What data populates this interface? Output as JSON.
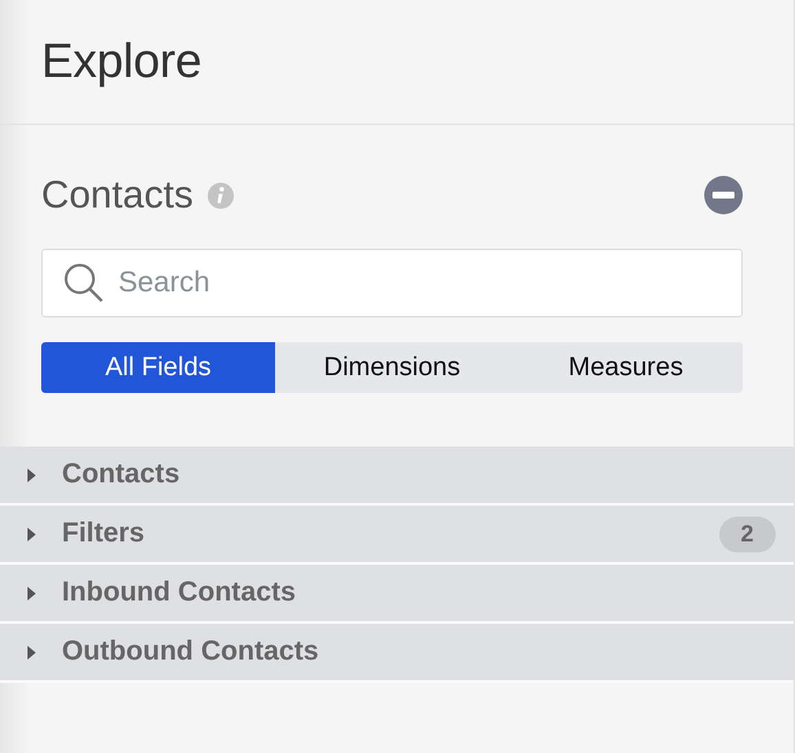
{
  "header": {
    "title": "Explore"
  },
  "explore": {
    "title": "Contacts",
    "search": {
      "placeholder": "Search"
    },
    "tabs": [
      {
        "label": "All Fields",
        "selected": true
      },
      {
        "label": "Dimensions",
        "selected": false
      },
      {
        "label": "Measures",
        "selected": false
      }
    ]
  },
  "groups": [
    {
      "label": "Contacts",
      "expanded": false
    },
    {
      "label": "Filters",
      "expanded": false,
      "count": "2"
    },
    {
      "label": "Inbound Contacts",
      "expanded": false
    },
    {
      "label": "Outbound Contacts",
      "expanded": false
    }
  ]
}
